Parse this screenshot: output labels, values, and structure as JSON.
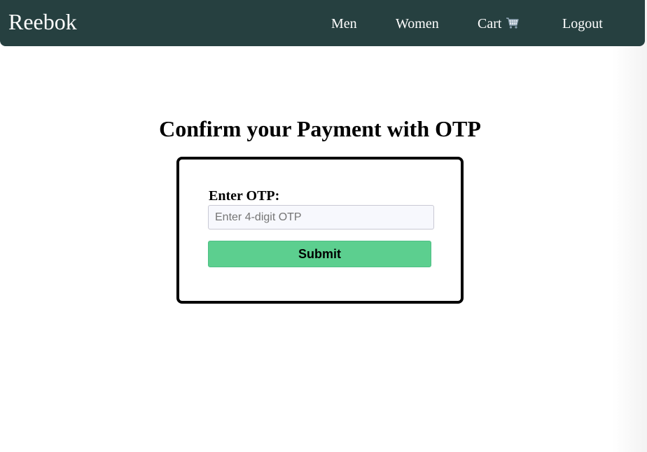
{
  "navbar": {
    "brand": "Reebok",
    "links": {
      "men": "Men",
      "women": "Women",
      "cart": "Cart",
      "cart_icon": "shopping-cart-icon",
      "logout": "Logout"
    },
    "background_color": "#264040"
  },
  "main": {
    "heading": "Confirm your Payment with OTP",
    "form": {
      "otp_label": "Enter OTP:",
      "otp_value": "",
      "otp_placeholder": "Enter 4-digit OTP",
      "submit_label": "Submit",
      "submit_color": "#5ccf8f"
    }
  }
}
